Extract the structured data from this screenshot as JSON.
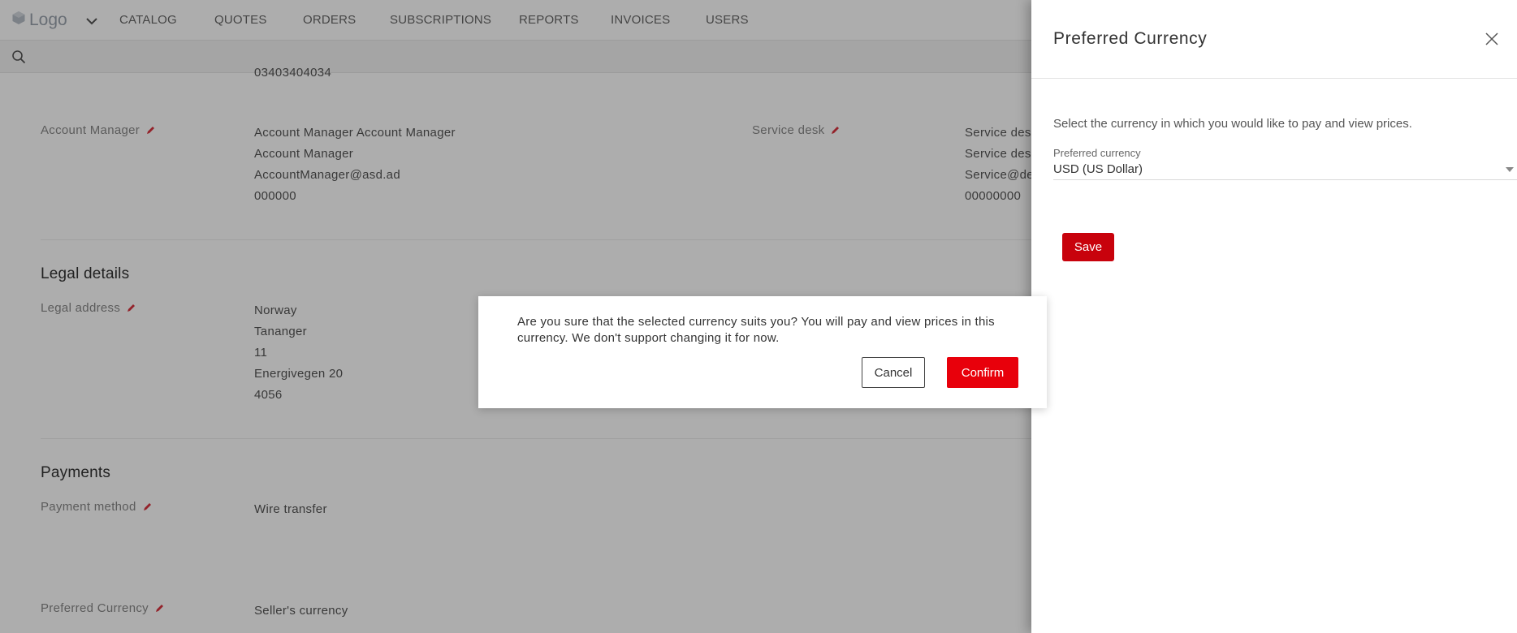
{
  "app": {
    "logo_text": "Logo"
  },
  "nav": {
    "items": [
      "CATALOG",
      "QUOTES",
      "ORDERS",
      "SUBSCRIPTIONS",
      "REPORTS",
      "INVOICES",
      "USERS"
    ]
  },
  "account": {
    "partial_phone": "03403404034",
    "account_manager": {
      "label": "Account Manager",
      "lines": [
        "Account Manager Account Manager",
        "Account Manager",
        "AccountManager@asd.ad",
        "000000"
      ]
    },
    "service_desk": {
      "label": "Service desk",
      "lines": [
        "Service des",
        "Service des",
        "Service@de",
        "00000000"
      ]
    }
  },
  "legal": {
    "title": "Legal details",
    "address_label": "Legal address",
    "address_lines": [
      "Norway",
      "Tananger",
      "11",
      "Energivegen 20",
      "4056"
    ]
  },
  "payments": {
    "title": "Payments",
    "method_label": "Payment method",
    "method_value": "Wire transfer",
    "currency_label": "Preferred Currency",
    "currency_value": "Seller's currency"
  },
  "drawer": {
    "title": "Preferred Currency",
    "description": "Select the currency in which you would like to pay and view prices.",
    "field_label": "Preferred currency",
    "selected_value": "USD (US Dollar)",
    "save_label": "Save"
  },
  "modal": {
    "message": "Are you sure that the selected currency suits you? You will pay and view prices in this currency. We don't support changing it for now.",
    "cancel_label": "Cancel",
    "confirm_label": "Confirm"
  },
  "colors": {
    "accent": "#e8000b",
    "save_button": "#c8020c",
    "pencil_icon": "#d9333f"
  },
  "icons": [
    "logo-cube-icon",
    "chevron-down-icon",
    "search-icon",
    "pencil-icon",
    "close-icon",
    "caret-down-icon"
  ]
}
